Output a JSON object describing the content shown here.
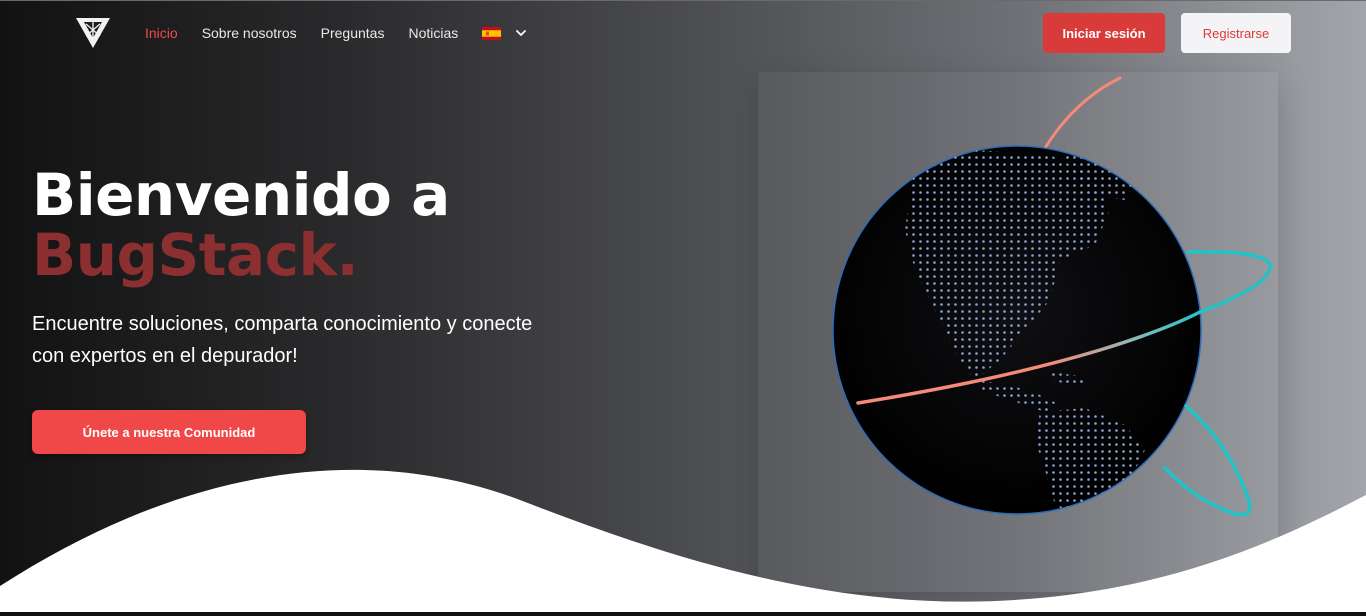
{
  "nav": {
    "items": [
      {
        "label": "Inicio",
        "active": true
      },
      {
        "label": "Sobre nosotros",
        "active": false
      },
      {
        "label": "Preguntas",
        "active": false
      },
      {
        "label": "Noticias",
        "active": false
      }
    ],
    "language_icon": "spain-flag-icon",
    "dropdown_icon": "chevron-down-icon"
  },
  "auth": {
    "login_label": "Iniciar sesión",
    "register_label": "Registrarse"
  },
  "hero": {
    "title_line1": "Bienvenido a",
    "title_line2": "BugStack.",
    "subtitle": "Encuentre soluciones, comparta conocimiento y conecte con expertos en el depurador!",
    "cta_label": "Únete a nuestra Comunidad"
  },
  "colors": {
    "accent": "#d93a3a",
    "brand_dark_red": "#8c2f30",
    "orbit_salmon": "#f58a78",
    "orbit_teal": "#1fc4c8"
  }
}
